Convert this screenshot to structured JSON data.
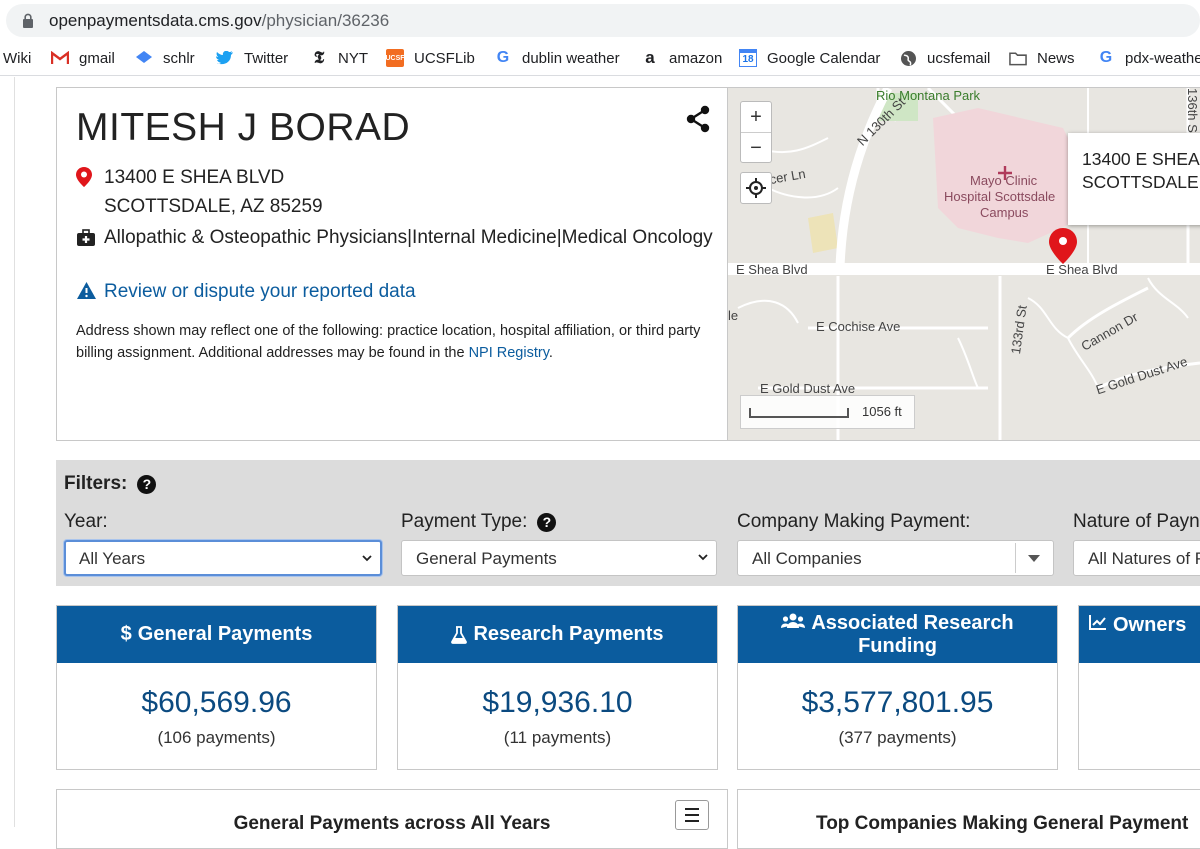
{
  "browser": {
    "url_domain": "openpaymentsdata.cms.gov",
    "url_path": "/physician/36236",
    "bookmarks": [
      {
        "label": "Wiki"
      },
      {
        "label": "gmail"
      },
      {
        "label": "schlr"
      },
      {
        "label": "Twitter"
      },
      {
        "label": "NYT"
      },
      {
        "label": "UCSFLib"
      },
      {
        "label": "dublin weather"
      },
      {
        "label": "amazon"
      },
      {
        "label": "Google Calendar",
        "badge": "18"
      },
      {
        "label": "ucsfemail"
      },
      {
        "label": "News"
      },
      {
        "label": "pdx-weathe"
      }
    ]
  },
  "physician": {
    "name": "MITESH J BORAD",
    "address_line1": "13400 E SHEA BLVD",
    "address_line2": "SCOTTSDALE, AZ 85259",
    "specialty": "Allopathic & Osteopathic Physicians|Internal Medicine|Medical Oncology",
    "review_link": "Review or dispute your reported data",
    "note_prefix": "Address shown may reflect one of the following: practice location, hospital affiliation, or third party billing assignment. Additional addresses may be found in the ",
    "note_link": "NPI Registry",
    "note_suffix": "."
  },
  "map": {
    "zoom_in": "+",
    "zoom_out": "−",
    "labels": {
      "park": "Rio Montana Park",
      "n130": "N 130th St",
      "mercer": "ercer Ln",
      "mayo": "Mayo Clinic",
      "hospital": "Hospital Scottsdale",
      "campus": "Campus",
      "shea_left": "E Shea Blvd",
      "shea_right": "E Shea Blvd",
      "cochise": "E Cochise Ave",
      "st133": "133rd St",
      "cannon": "Cannon Dr",
      "gold_left": "E Gold Dust Ave",
      "gold_right": "E Gold Dust Ave",
      "le": "le",
      "st136": "136th S"
    },
    "popup_line1": "13400 E SHEA",
    "popup_line2": "SCOTTSDALE",
    "scale": "1056 ft"
  },
  "filters": {
    "title": "Filters:",
    "year_label": "Year:",
    "year_value": "All Years",
    "payment_type_label": "Payment Type:",
    "payment_type_value": "General Payments",
    "company_label": "Company Making Payment:",
    "company_value": "All Companies",
    "nature_label": "Nature of Payn",
    "nature_value": "All Natures of P"
  },
  "summary": [
    {
      "title": "General Payments",
      "icon": "dollar-icon",
      "amount": "$60,569.96",
      "count": "(106 payments)"
    },
    {
      "title": "Research Payments",
      "icon": "flask-icon",
      "amount": "$19,936.10",
      "count": "(11 payments)"
    },
    {
      "title": "Associated Research Funding",
      "icon": "users-icon",
      "amount": "$3,577,801.95",
      "count": "(377 payments)"
    },
    {
      "title": "Owners",
      "icon": "line-chart-icon",
      "amount": "",
      "count": ""
    }
  ],
  "panels": {
    "general_across_years": "General Payments across All Years",
    "top_companies": "Top Companies Making General Payment"
  },
  "colors": {
    "brand_blue": "#0b5c9e",
    "amount_blue": "#0b4a80",
    "link_blue": "#0b5c9e",
    "filter_bg": "#dcdcdc",
    "pin_red": "#e0161b"
  }
}
